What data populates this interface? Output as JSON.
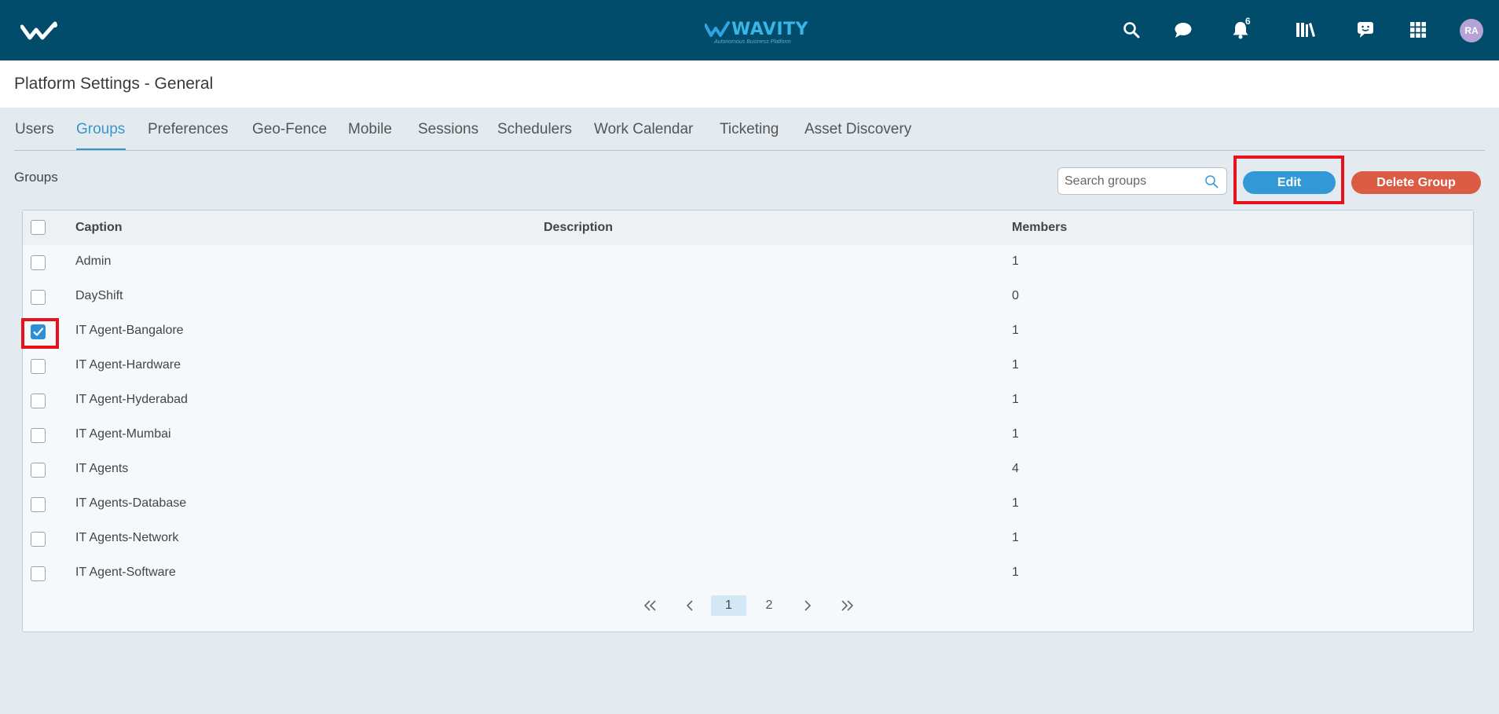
{
  "header": {
    "brand_name": "WAVITY",
    "brand_tagline": "Autonomous Business Platform",
    "notification_count": "6",
    "avatar_initials": "RA",
    "icons": [
      "search-icon",
      "chat-icon",
      "bell-icon",
      "library-icon",
      "feedback-icon",
      "apps-grid-icon"
    ]
  },
  "page": {
    "title": "Platform Settings - General"
  },
  "tabs": [
    {
      "label": "Users",
      "active": false
    },
    {
      "label": "Groups",
      "active": true
    },
    {
      "label": "Preferences",
      "active": false
    },
    {
      "label": "Geo-Fence",
      "active": false
    },
    {
      "label": "Mobile",
      "active": false
    },
    {
      "label": "Sessions",
      "active": false
    },
    {
      "label": "Schedulers",
      "active": false
    },
    {
      "label": "Work Calendar",
      "active": false
    },
    {
      "label": "Ticketing",
      "active": false
    },
    {
      "label": "Asset Discovery",
      "active": false
    }
  ],
  "groups": {
    "section_label": "Groups",
    "search_placeholder": "Search groups",
    "edit_label": "Edit",
    "delete_label": "Delete Group"
  },
  "table": {
    "columns": [
      "Caption",
      "Description",
      "Members"
    ],
    "rows": [
      {
        "caption": "Admin",
        "description": "",
        "members": "1",
        "checked": false
      },
      {
        "caption": "DayShift",
        "description": "",
        "members": "0",
        "checked": false
      },
      {
        "caption": "IT Agent-Bangalore",
        "description": "",
        "members": "1",
        "checked": true
      },
      {
        "caption": "IT Agent-Hardware",
        "description": "",
        "members": "1",
        "checked": false
      },
      {
        "caption": "IT Agent-Hyderabad",
        "description": "",
        "members": "1",
        "checked": false
      },
      {
        "caption": "IT Agent-Mumbai",
        "description": "",
        "members": "1",
        "checked": false
      },
      {
        "caption": "IT Agents",
        "description": "",
        "members": "4",
        "checked": false
      },
      {
        "caption": "IT Agents-Database",
        "description": "",
        "members": "1",
        "checked": false
      },
      {
        "caption": "IT Agents-Network",
        "description": "",
        "members": "1",
        "checked": false
      },
      {
        "caption": "IT Agent-Software",
        "description": "",
        "members": "1",
        "checked": false
      }
    ]
  },
  "pagination": {
    "pages": [
      "1",
      "2"
    ],
    "current_page": "1"
  },
  "colors": {
    "header_bg": "#014b6b",
    "accent": "#3399d6",
    "danger": "#db5b44",
    "highlight": "#e8101b"
  }
}
